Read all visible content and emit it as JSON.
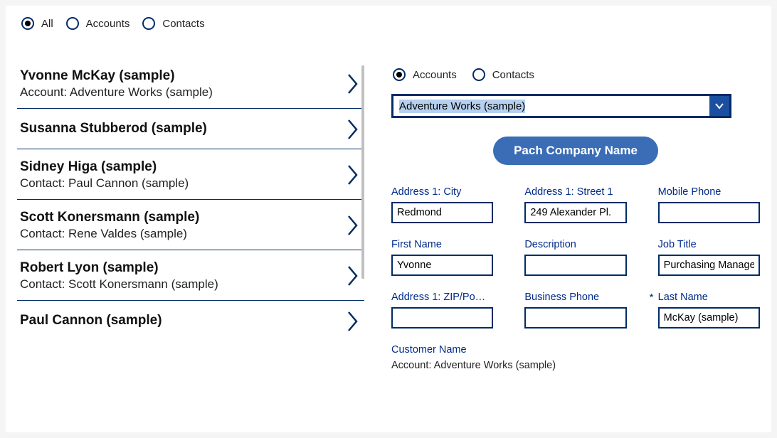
{
  "topFilter": {
    "options": [
      {
        "label": "All",
        "selected": true
      },
      {
        "label": "Accounts",
        "selected": false
      },
      {
        "label": "Contacts",
        "selected": false
      }
    ]
  },
  "list": [
    {
      "title": "Yvonne McKay (sample)",
      "sub": "Account: Adventure Works (sample)"
    },
    {
      "title": "Susanna Stubberod (sample)",
      "sub": ""
    },
    {
      "title": "Sidney Higa (sample)",
      "sub": "Contact: Paul Cannon (sample)"
    },
    {
      "title": "Scott Konersmann (sample)",
      "sub": "Contact: Rene Valdes (sample)"
    },
    {
      "title": "Robert Lyon (sample)",
      "sub": "Contact: Scott Konersmann (sample)"
    },
    {
      "title": "Paul Cannon (sample)",
      "sub": ""
    }
  ],
  "detail": {
    "filter": {
      "options": [
        {
          "label": "Accounts",
          "selected": true
        },
        {
          "label": "Contacts",
          "selected": false
        }
      ]
    },
    "dropdown": "Adventure Works (sample)",
    "patchButton": "Pach Company Name",
    "fields": {
      "addressCity": {
        "label": "Address 1: City",
        "value": "Redmond"
      },
      "addressStreet": {
        "label": "Address 1: Street 1",
        "value": "249 Alexander Pl."
      },
      "mobilePhone": {
        "label": "Mobile Phone",
        "value": ""
      },
      "firstName": {
        "label": "First Name",
        "value": "Yvonne"
      },
      "description": {
        "label": "Description",
        "value": ""
      },
      "jobTitle": {
        "label": "Job Title",
        "value": "Purchasing Manager"
      },
      "addressZip": {
        "label": "Address 1: ZIP/Po…",
        "value": ""
      },
      "businessPhone": {
        "label": "Business Phone",
        "value": ""
      },
      "lastName": {
        "label": "Last Name",
        "value": "McKay (sample)",
        "required": true
      }
    },
    "customer": {
      "label": "Customer Name",
      "value": "Account: Adventure Works (sample)"
    }
  }
}
